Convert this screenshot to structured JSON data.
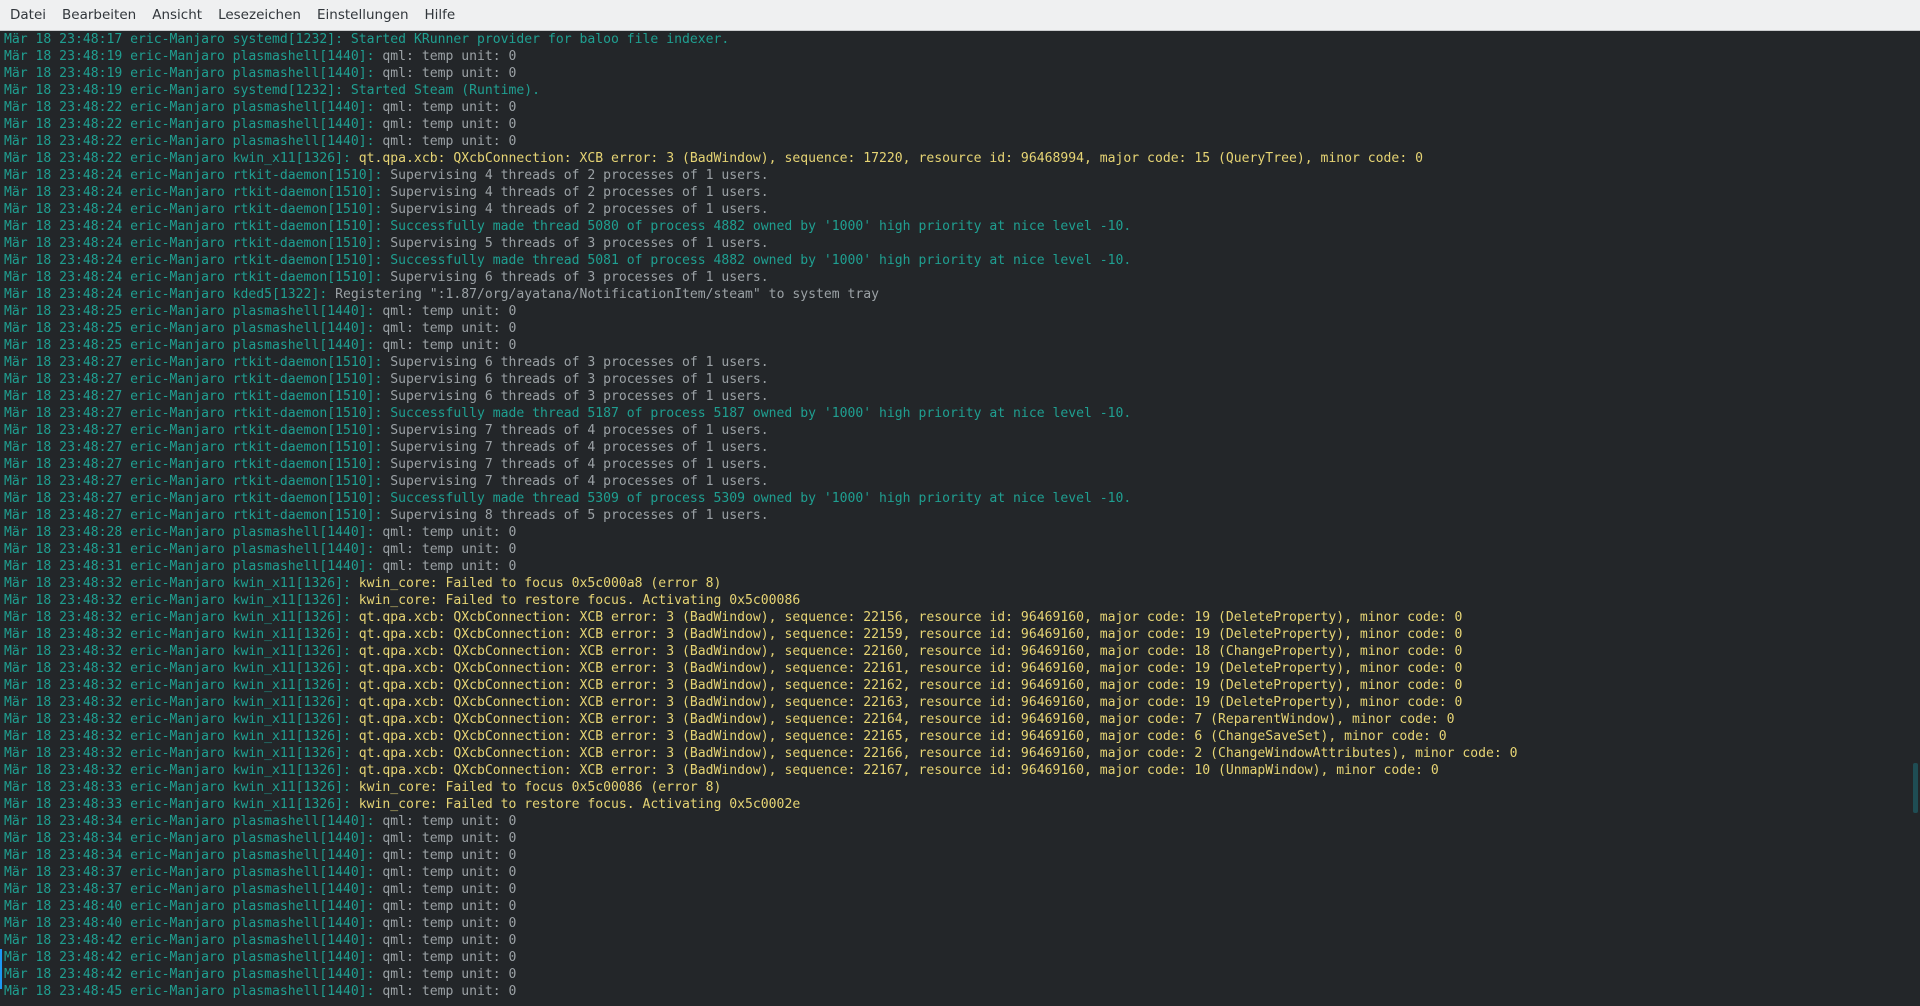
{
  "menu": [
    "Datei",
    "Bearbeiten",
    "Ansicht",
    "Lesezeichen",
    "Einstellungen",
    "Hilfe"
  ],
  "lines": [
    {
      "type": "systemd",
      "pre": "Mär 18 23:48:17 eric-Manjaro systemd[1232]:",
      "msg": "Started KRunner provider for baloo file indexer."
    },
    {
      "type": "plasma",
      "pre": "Mär 18 23:48:19 eric-Manjaro plasmashell[1440]:",
      "msg": "qml: temp unit: 0"
    },
    {
      "type": "plasma",
      "pre": "Mär 18 23:48:19 eric-Manjaro plasmashell[1440]:",
      "msg": "qml: temp unit: 0"
    },
    {
      "type": "systemd",
      "pre": "Mär 18 23:48:19 eric-Manjaro systemd[1232]:",
      "msg": "Started Steam (Runtime)."
    },
    {
      "type": "plasma",
      "pre": "Mär 18 23:48:22 eric-Manjaro plasmashell[1440]:",
      "msg": "qml: temp unit: 0"
    },
    {
      "type": "plasma",
      "pre": "Mär 18 23:48:22 eric-Manjaro plasmashell[1440]:",
      "msg": "qml: temp unit: 0"
    },
    {
      "type": "plasma",
      "pre": "Mär 18 23:48:22 eric-Manjaro plasmashell[1440]:",
      "msg": "qml: temp unit: 0"
    },
    {
      "type": "kwin",
      "pre": "Mär 18 23:48:22 eric-Manjaro kwin_x11[1326]:",
      "msg": "qt.qpa.xcb: QXcbConnection: XCB error: 3 (BadWindow), sequence: 17220, resource id: 96468994, major code: 15 (QueryTree), minor code: 0"
    },
    {
      "type": "rtkit",
      "pre": "Mär 18 23:48:24 eric-Manjaro rtkit-daemon[1510]:",
      "msg": "Supervising 4 threads of 2 processes of 1 users."
    },
    {
      "type": "rtkit",
      "pre": "Mär 18 23:48:24 eric-Manjaro rtkit-daemon[1510]:",
      "msg": "Supervising 4 threads of 2 processes of 1 users."
    },
    {
      "type": "rtkit",
      "pre": "Mär 18 23:48:24 eric-Manjaro rtkit-daemon[1510]:",
      "msg": "Supervising 4 threads of 2 processes of 1 users."
    },
    {
      "type": "success",
      "pre": "Mär 18 23:48:24 eric-Manjaro rtkit-daemon[1510]:",
      "msg": "Successfully made thread 5080 of process 4882 owned by '1000' high priority at nice level -10."
    },
    {
      "type": "rtkit",
      "pre": "Mär 18 23:48:24 eric-Manjaro rtkit-daemon[1510]:",
      "msg": "Supervising 5 threads of 3 processes of 1 users."
    },
    {
      "type": "success",
      "pre": "Mär 18 23:48:24 eric-Manjaro rtkit-daemon[1510]:",
      "msg": "Successfully made thread 5081 of process 4882 owned by '1000' high priority at nice level -10."
    },
    {
      "type": "rtkit",
      "pre": "Mär 18 23:48:24 eric-Manjaro rtkit-daemon[1510]:",
      "msg": "Supervising 6 threads of 3 processes of 1 users."
    },
    {
      "type": "kded",
      "pre": "Mär 18 23:48:24 eric-Manjaro kded5[1322]:",
      "msg": "Registering \":1.87/org/ayatana/NotificationItem/steam\" to system tray"
    },
    {
      "type": "plasma",
      "pre": "Mär 18 23:48:25 eric-Manjaro plasmashell[1440]:",
      "msg": "qml: temp unit: 0"
    },
    {
      "type": "plasma",
      "pre": "Mär 18 23:48:25 eric-Manjaro plasmashell[1440]:",
      "msg": "qml: temp unit: 0"
    },
    {
      "type": "plasma",
      "pre": "Mär 18 23:48:25 eric-Manjaro plasmashell[1440]:",
      "msg": "qml: temp unit: 0"
    },
    {
      "type": "rtkit",
      "pre": "Mär 18 23:48:27 eric-Manjaro rtkit-daemon[1510]:",
      "msg": "Supervising 6 threads of 3 processes of 1 users."
    },
    {
      "type": "rtkit",
      "pre": "Mär 18 23:48:27 eric-Manjaro rtkit-daemon[1510]:",
      "msg": "Supervising 6 threads of 3 processes of 1 users."
    },
    {
      "type": "rtkit",
      "pre": "Mär 18 23:48:27 eric-Manjaro rtkit-daemon[1510]:",
      "msg": "Supervising 6 threads of 3 processes of 1 users."
    },
    {
      "type": "success",
      "pre": "Mär 18 23:48:27 eric-Manjaro rtkit-daemon[1510]:",
      "msg": "Successfully made thread 5187 of process 5187 owned by '1000' high priority at nice level -10."
    },
    {
      "type": "rtkit",
      "pre": "Mär 18 23:48:27 eric-Manjaro rtkit-daemon[1510]:",
      "msg": "Supervising 7 threads of 4 processes of 1 users."
    },
    {
      "type": "rtkit",
      "pre": "Mär 18 23:48:27 eric-Manjaro rtkit-daemon[1510]:",
      "msg": "Supervising 7 threads of 4 processes of 1 users."
    },
    {
      "type": "rtkit",
      "pre": "Mär 18 23:48:27 eric-Manjaro rtkit-daemon[1510]:",
      "msg": "Supervising 7 threads of 4 processes of 1 users."
    },
    {
      "type": "rtkit",
      "pre": "Mär 18 23:48:27 eric-Manjaro rtkit-daemon[1510]:",
      "msg": "Supervising 7 threads of 4 processes of 1 users."
    },
    {
      "type": "success",
      "pre": "Mär 18 23:48:27 eric-Manjaro rtkit-daemon[1510]:",
      "msg": "Successfully made thread 5309 of process 5309 owned by '1000' high priority at nice level -10."
    },
    {
      "type": "rtkit",
      "pre": "Mär 18 23:48:27 eric-Manjaro rtkit-daemon[1510]:",
      "msg": "Supervising 8 threads of 5 processes of 1 users."
    },
    {
      "type": "plasma",
      "pre": "Mär 18 23:48:28 eric-Manjaro plasmashell[1440]:",
      "msg": "qml: temp unit: 0"
    },
    {
      "type": "plasma",
      "pre": "Mär 18 23:48:31 eric-Manjaro plasmashell[1440]:",
      "msg": "qml: temp unit: 0"
    },
    {
      "type": "plasma",
      "pre": "Mär 18 23:48:31 eric-Manjaro plasmashell[1440]:",
      "msg": "qml: temp unit: 0"
    },
    {
      "type": "kwin",
      "pre": "Mär 18 23:48:32 eric-Manjaro kwin_x11[1326]:",
      "msg": "kwin_core: Failed to focus 0x5c000a8 (error 8)"
    },
    {
      "type": "kwin",
      "pre": "Mär 18 23:48:32 eric-Manjaro kwin_x11[1326]:",
      "msg": "kwin_core: Failed to restore focus. Activating 0x5c00086"
    },
    {
      "type": "kwin",
      "pre": "Mär 18 23:48:32 eric-Manjaro kwin_x11[1326]:",
      "msg": "qt.qpa.xcb: QXcbConnection: XCB error: 3 (BadWindow), sequence: 22156, resource id: 96469160, major code: 19 (DeleteProperty), minor code: 0"
    },
    {
      "type": "kwin",
      "pre": "Mär 18 23:48:32 eric-Manjaro kwin_x11[1326]:",
      "msg": "qt.qpa.xcb: QXcbConnection: XCB error: 3 (BadWindow), sequence: 22159, resource id: 96469160, major code: 19 (DeleteProperty), minor code: 0"
    },
    {
      "type": "kwin",
      "pre": "Mär 18 23:48:32 eric-Manjaro kwin_x11[1326]:",
      "msg": "qt.qpa.xcb: QXcbConnection: XCB error: 3 (BadWindow), sequence: 22160, resource id: 96469160, major code: 18 (ChangeProperty), minor code: 0"
    },
    {
      "type": "kwin",
      "pre": "Mär 18 23:48:32 eric-Manjaro kwin_x11[1326]:",
      "msg": "qt.qpa.xcb: QXcbConnection: XCB error: 3 (BadWindow), sequence: 22161, resource id: 96469160, major code: 19 (DeleteProperty), minor code: 0"
    },
    {
      "type": "kwin",
      "pre": "Mär 18 23:48:32 eric-Manjaro kwin_x11[1326]:",
      "msg": "qt.qpa.xcb: QXcbConnection: XCB error: 3 (BadWindow), sequence: 22162, resource id: 96469160, major code: 19 (DeleteProperty), minor code: 0"
    },
    {
      "type": "kwin",
      "pre": "Mär 18 23:48:32 eric-Manjaro kwin_x11[1326]:",
      "msg": "qt.qpa.xcb: QXcbConnection: XCB error: 3 (BadWindow), sequence: 22163, resource id: 96469160, major code: 19 (DeleteProperty), minor code: 0"
    },
    {
      "type": "kwin",
      "pre": "Mär 18 23:48:32 eric-Manjaro kwin_x11[1326]:",
      "msg": "qt.qpa.xcb: QXcbConnection: XCB error: 3 (BadWindow), sequence: 22164, resource id: 96469160, major code: 7 (ReparentWindow), minor code: 0"
    },
    {
      "type": "kwin",
      "pre": "Mär 18 23:48:32 eric-Manjaro kwin_x11[1326]:",
      "msg": "qt.qpa.xcb: QXcbConnection: XCB error: 3 (BadWindow), sequence: 22165, resource id: 96469160, major code: 6 (ChangeSaveSet), minor code: 0"
    },
    {
      "type": "kwin",
      "pre": "Mär 18 23:48:32 eric-Manjaro kwin_x11[1326]:",
      "msg": "qt.qpa.xcb: QXcbConnection: XCB error: 3 (BadWindow), sequence: 22166, resource id: 96469160, major code: 2 (ChangeWindowAttributes), minor code: 0"
    },
    {
      "type": "kwin",
      "pre": "Mär 18 23:48:32 eric-Manjaro kwin_x11[1326]:",
      "msg": "qt.qpa.xcb: QXcbConnection: XCB error: 3 (BadWindow), sequence: 22167, resource id: 96469160, major code: 10 (UnmapWindow), minor code: 0"
    },
    {
      "type": "kwin",
      "pre": "Mär 18 23:48:33 eric-Manjaro kwin_x11[1326]:",
      "msg": "kwin_core: Failed to focus 0x5c00086 (error 8)"
    },
    {
      "type": "kwin",
      "pre": "Mär 18 23:48:33 eric-Manjaro kwin_x11[1326]:",
      "msg": "kwin_core: Failed to restore focus. Activating 0x5c0002e"
    },
    {
      "type": "plasma",
      "pre": "Mär 18 23:48:34 eric-Manjaro plasmashell[1440]:",
      "msg": "qml: temp unit: 0"
    },
    {
      "type": "plasma",
      "pre": "Mär 18 23:48:34 eric-Manjaro plasmashell[1440]:",
      "msg": "qml: temp unit: 0"
    },
    {
      "type": "plasma",
      "pre": "Mär 18 23:48:34 eric-Manjaro plasmashell[1440]:",
      "msg": "qml: temp unit: 0"
    },
    {
      "type": "plasma",
      "pre": "Mär 18 23:48:37 eric-Manjaro plasmashell[1440]:",
      "msg": "qml: temp unit: 0"
    },
    {
      "type": "plasma",
      "pre": "Mär 18 23:48:37 eric-Manjaro plasmashell[1440]:",
      "msg": "qml: temp unit: 0"
    },
    {
      "type": "plasma",
      "pre": "Mär 18 23:48:40 eric-Manjaro plasmashell[1440]:",
      "msg": "qml: temp unit: 0"
    },
    {
      "type": "plasma",
      "pre": "Mär 18 23:48:40 eric-Manjaro plasmashell[1440]:",
      "msg": "qml: temp unit: 0"
    },
    {
      "type": "plasma",
      "pre": "Mär 18 23:48:42 eric-Manjaro plasmashell[1440]:",
      "msg": "qml: temp unit: 0"
    },
    {
      "type": "plasma",
      "pre": "Mär 18 23:48:42 eric-Manjaro plasmashell[1440]:",
      "msg": "qml: temp unit: 0"
    },
    {
      "type": "plasma",
      "pre": "Mär 18 23:48:42 eric-Manjaro plasmashell[1440]:",
      "msg": "qml: temp unit: 0"
    },
    {
      "type": "plasma",
      "pre": "Mär 18 23:48:45 eric-Manjaro plasmashell[1440]:",
      "msg": "qml: temp unit: 0"
    }
  ]
}
